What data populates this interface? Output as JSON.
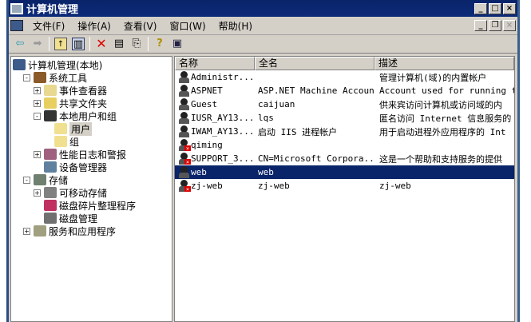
{
  "window": {
    "title": "计算机管理"
  },
  "menu": [
    "文件(F)",
    "操作(A)",
    "查看(V)",
    "窗口(W)",
    "帮助(H)"
  ],
  "tree": [
    {
      "label": "计算机管理(本地)",
      "level": 0,
      "toggle": "",
      "color": "#3c5a8a"
    },
    {
      "label": "系统工具",
      "level": 1,
      "toggle": "−",
      "color": "#8a5a2a"
    },
    {
      "label": "事件查看器",
      "level": 2,
      "toggle": "+",
      "color": "#e8d890"
    },
    {
      "label": "共享文件夹",
      "level": 2,
      "toggle": "+",
      "color": "#e8d060"
    },
    {
      "label": "本地用户和组",
      "level": 2,
      "toggle": "−",
      "color": "#333"
    },
    {
      "label": "用户",
      "level": 3,
      "toggle": "",
      "color": "#f0e090",
      "selected": true
    },
    {
      "label": "组",
      "level": 3,
      "toggle": "",
      "color": "#f0e090"
    },
    {
      "label": "性能日志和警报",
      "level": 2,
      "toggle": "+",
      "color": "#a06080"
    },
    {
      "label": "设备管理器",
      "level": 2,
      "toggle": "",
      "color": "#6080a0"
    },
    {
      "label": "存储",
      "level": 1,
      "toggle": "−",
      "color": "#708070"
    },
    {
      "label": "可移动存储",
      "level": 2,
      "toggle": "+",
      "color": "#808080"
    },
    {
      "label": "磁盘碎片整理程序",
      "level": 2,
      "toggle": "",
      "color": "#c03060"
    },
    {
      "label": "磁盘管理",
      "level": 2,
      "toggle": "",
      "color": "#707070"
    },
    {
      "label": "服务和应用程序",
      "level": 1,
      "toggle": "+",
      "color": "#a0a080"
    }
  ],
  "columns": [
    "名称",
    "全名",
    "描述"
  ],
  "users": [
    {
      "name": "Administr...",
      "full": "",
      "desc": "管理计算机(域)的内置帐户",
      "disabled": false
    },
    {
      "name": "ASPNET",
      "full": "ASP.NET Machine Account",
      "desc": "Account used for running the",
      "disabled": false
    },
    {
      "name": "Guest",
      "full": "caijuan",
      "desc": "供来宾访问计算机或访问域的内",
      "disabled": false
    },
    {
      "name": "IUSR_AY13...",
      "full": "lqs",
      "desc": "匿名访问 Internet 信息服务的",
      "disabled": false
    },
    {
      "name": "IWAM_AY13...",
      "full": "启动 IIS 进程帐户",
      "desc": "用于启动进程外应用程序的 Int",
      "disabled": false
    },
    {
      "name": "qiming",
      "full": "",
      "desc": "",
      "disabled": true
    },
    {
      "name": "SUPPORT_3...",
      "full": "CN=Microsoft Corpora...",
      "desc": "这是一个帮助和支持服务的提供",
      "disabled": true
    },
    {
      "name": "web",
      "full": "web",
      "desc": "",
      "disabled": false,
      "selected": true
    },
    {
      "name": "zj-web",
      "full": "zj-web",
      "desc": "zj-web",
      "disabled": true
    }
  ]
}
